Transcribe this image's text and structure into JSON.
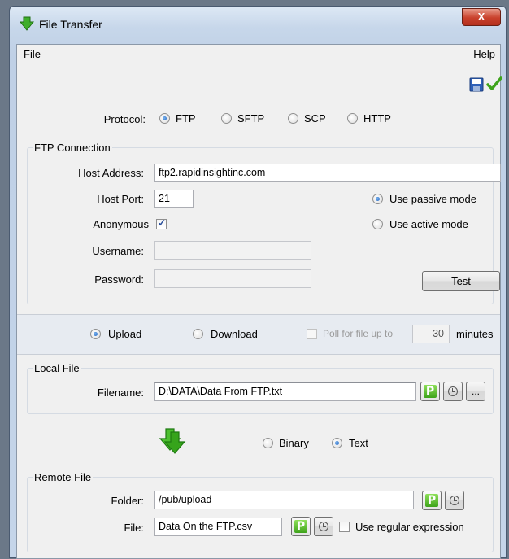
{
  "window": {
    "title": "File Transfer",
    "close_label": "X"
  },
  "menu": {
    "file": "File",
    "help": "Help"
  },
  "toolbar": {
    "save_icon": "save-icon",
    "ok_icon": "checkmark-icon"
  },
  "protocol": {
    "label": "Protocol:",
    "options": [
      "FTP",
      "SFTP",
      "SCP",
      "HTTP"
    ],
    "selected": "FTP"
  },
  "ftp_connection": {
    "group_title": "FTP Connection",
    "host_label": "Host Address:",
    "host_value": "ftp2.rapidinsightinc.com",
    "port_label": "Host Port:",
    "port_value": "21",
    "anonymous_label": "Anonymous",
    "anonymous_checked": true,
    "username_label": "Username:",
    "username_value": "",
    "password_label": "Password:",
    "password_value": "",
    "passive_label": "Use passive mode",
    "active_label": "Use active mode",
    "mode_selected": "passive",
    "test_label": "Test"
  },
  "direction": {
    "upload_label": "Upload",
    "download_label": "Download",
    "selected": "Upload",
    "poll_label": "Poll for file up to",
    "poll_value": "30",
    "minutes_label": "minutes"
  },
  "local_file": {
    "group_title": "Local File",
    "filename_label": "Filename:",
    "filename_value": "D:\\DATA\\Data From FTP.txt",
    "browse_label": "..."
  },
  "transfer_mode": {
    "binary_label": "Binary",
    "text_label": "Text",
    "selected": "Text"
  },
  "remote_file": {
    "group_title": "Remote File",
    "folder_label": "Folder:",
    "folder_value": "/pub/upload",
    "file_label": "File:",
    "file_value": "Data On the FTP.csv",
    "regex_label": "Use regular expression",
    "regex_checked": false
  },
  "param_button_label": "P",
  "colors": {
    "accent_green": "#3ea31a",
    "close_red": "#c9412c",
    "radio_blue": "#1b5fbf"
  }
}
